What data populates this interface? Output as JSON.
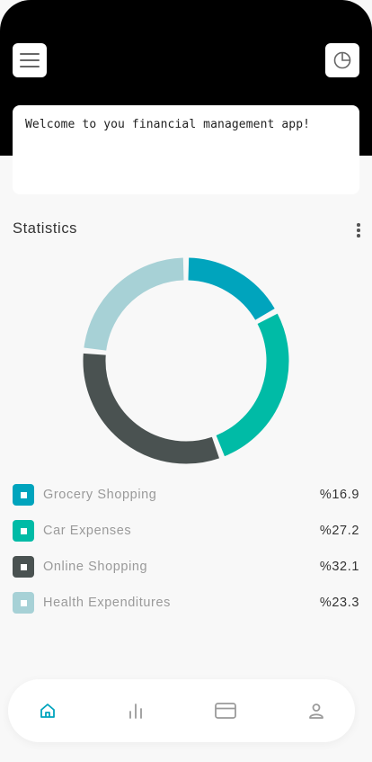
{
  "header": {
    "menu_icon": "hamburger-menu-icon",
    "report_icon": "pie-chart-icon"
  },
  "welcome": {
    "text": "Welcome to you financial management app!"
  },
  "statistics": {
    "title": "Statistics",
    "more_icon": "vertical-dots-icon"
  },
  "colors": {
    "grocery": "#00a4bd",
    "car": "#00bba6",
    "online": "#4a5251",
    "health": "#a7d1d6",
    "nav_active": "#00a4bd",
    "nav_inactive": "#9a9a9a"
  },
  "chart_data": {
    "type": "pie",
    "categories": [
      "Grocery Shopping",
      "Car Expenses",
      "Online Shopping",
      "Health Expenditures"
    ],
    "values": [
      16.9,
      27.2,
      32.1,
      23.3
    ],
    "value_labels": [
      "%16.9",
      "%27.2",
      "%32.1",
      "%23.3"
    ],
    "donut": true
  },
  "legend": [
    {
      "label": "Grocery Shopping",
      "value": "%16.9",
      "color": "#00a4bd"
    },
    {
      "label": "Car Expenses",
      "value": "%27.2",
      "color": "#00bba6"
    },
    {
      "label": "Online Shopping",
      "value": "%32.1",
      "color": "#4a5251"
    },
    {
      "label": "Health Expenditures",
      "value": "%23.3",
      "color": "#a7d1d6"
    }
  ],
  "bottom_nav": {
    "items": [
      {
        "icon": "home-icon",
        "active": true
      },
      {
        "icon": "bar-chart-icon",
        "active": false
      },
      {
        "icon": "credit-card-icon",
        "active": false
      },
      {
        "icon": "user-icon",
        "active": false
      }
    ]
  }
}
